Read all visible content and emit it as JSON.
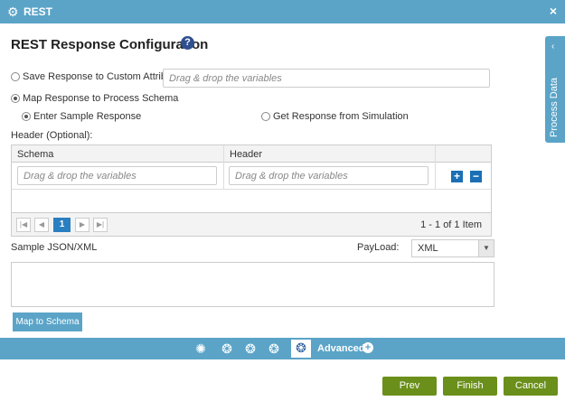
{
  "window": {
    "title": "REST",
    "gear_icon": "gear-icon",
    "close_glyph": "×"
  },
  "side_tab": {
    "label": "Process Data",
    "chevron": "‹"
  },
  "heading": {
    "title": "REST Response Configuration",
    "help_glyph": "?"
  },
  "options": {
    "save_custom_label": "Save Response to Custom Attribute",
    "save_custom_placeholder": "Drag & drop the variables",
    "map_schema_label": "Map Response to Process Schema",
    "enter_sample_label": "Enter Sample Response",
    "get_simulation_label": "Get Response from Simulation",
    "selected": "map_schema",
    "sub_selected": "enter_sample"
  },
  "header_section": {
    "label": "Header (Optional):",
    "columns": [
      "Schema",
      "Header"
    ],
    "rows": [
      {
        "schema_placeholder": "Drag & drop the variables",
        "header_placeholder": "Drag & drop the variables"
      }
    ],
    "pager": {
      "first": "|◀",
      "prev": "◀",
      "page": "1",
      "next": "▶",
      "last": "▶|",
      "count": "1 - 1 of 1 Item"
    },
    "add_glyph": "+",
    "remove_glyph": "−"
  },
  "sample": {
    "label": "Sample JSON/XML",
    "payload_label": "PayLoad:",
    "payload_value": "XML",
    "payload_arrow": "▼",
    "text": "",
    "map_button": "Map to Schema"
  },
  "toolbar": {
    "icons": [
      "globe-settings-icon",
      "globe-gear-icon-1",
      "globe-gear-icon-2",
      "globe-gear-icon-3",
      "globe-rest-icon"
    ],
    "advanced_label": "Advanced",
    "advanced_plus": "+"
  },
  "footer": {
    "prev": "Prev",
    "finish": "Finish",
    "cancel": "Cancel"
  },
  "colors": {
    "accent": "#5ba4c8",
    "footer_button": "#6a8f1a",
    "primary_blue": "#1a6fb5",
    "help": "#2f4f8f"
  }
}
